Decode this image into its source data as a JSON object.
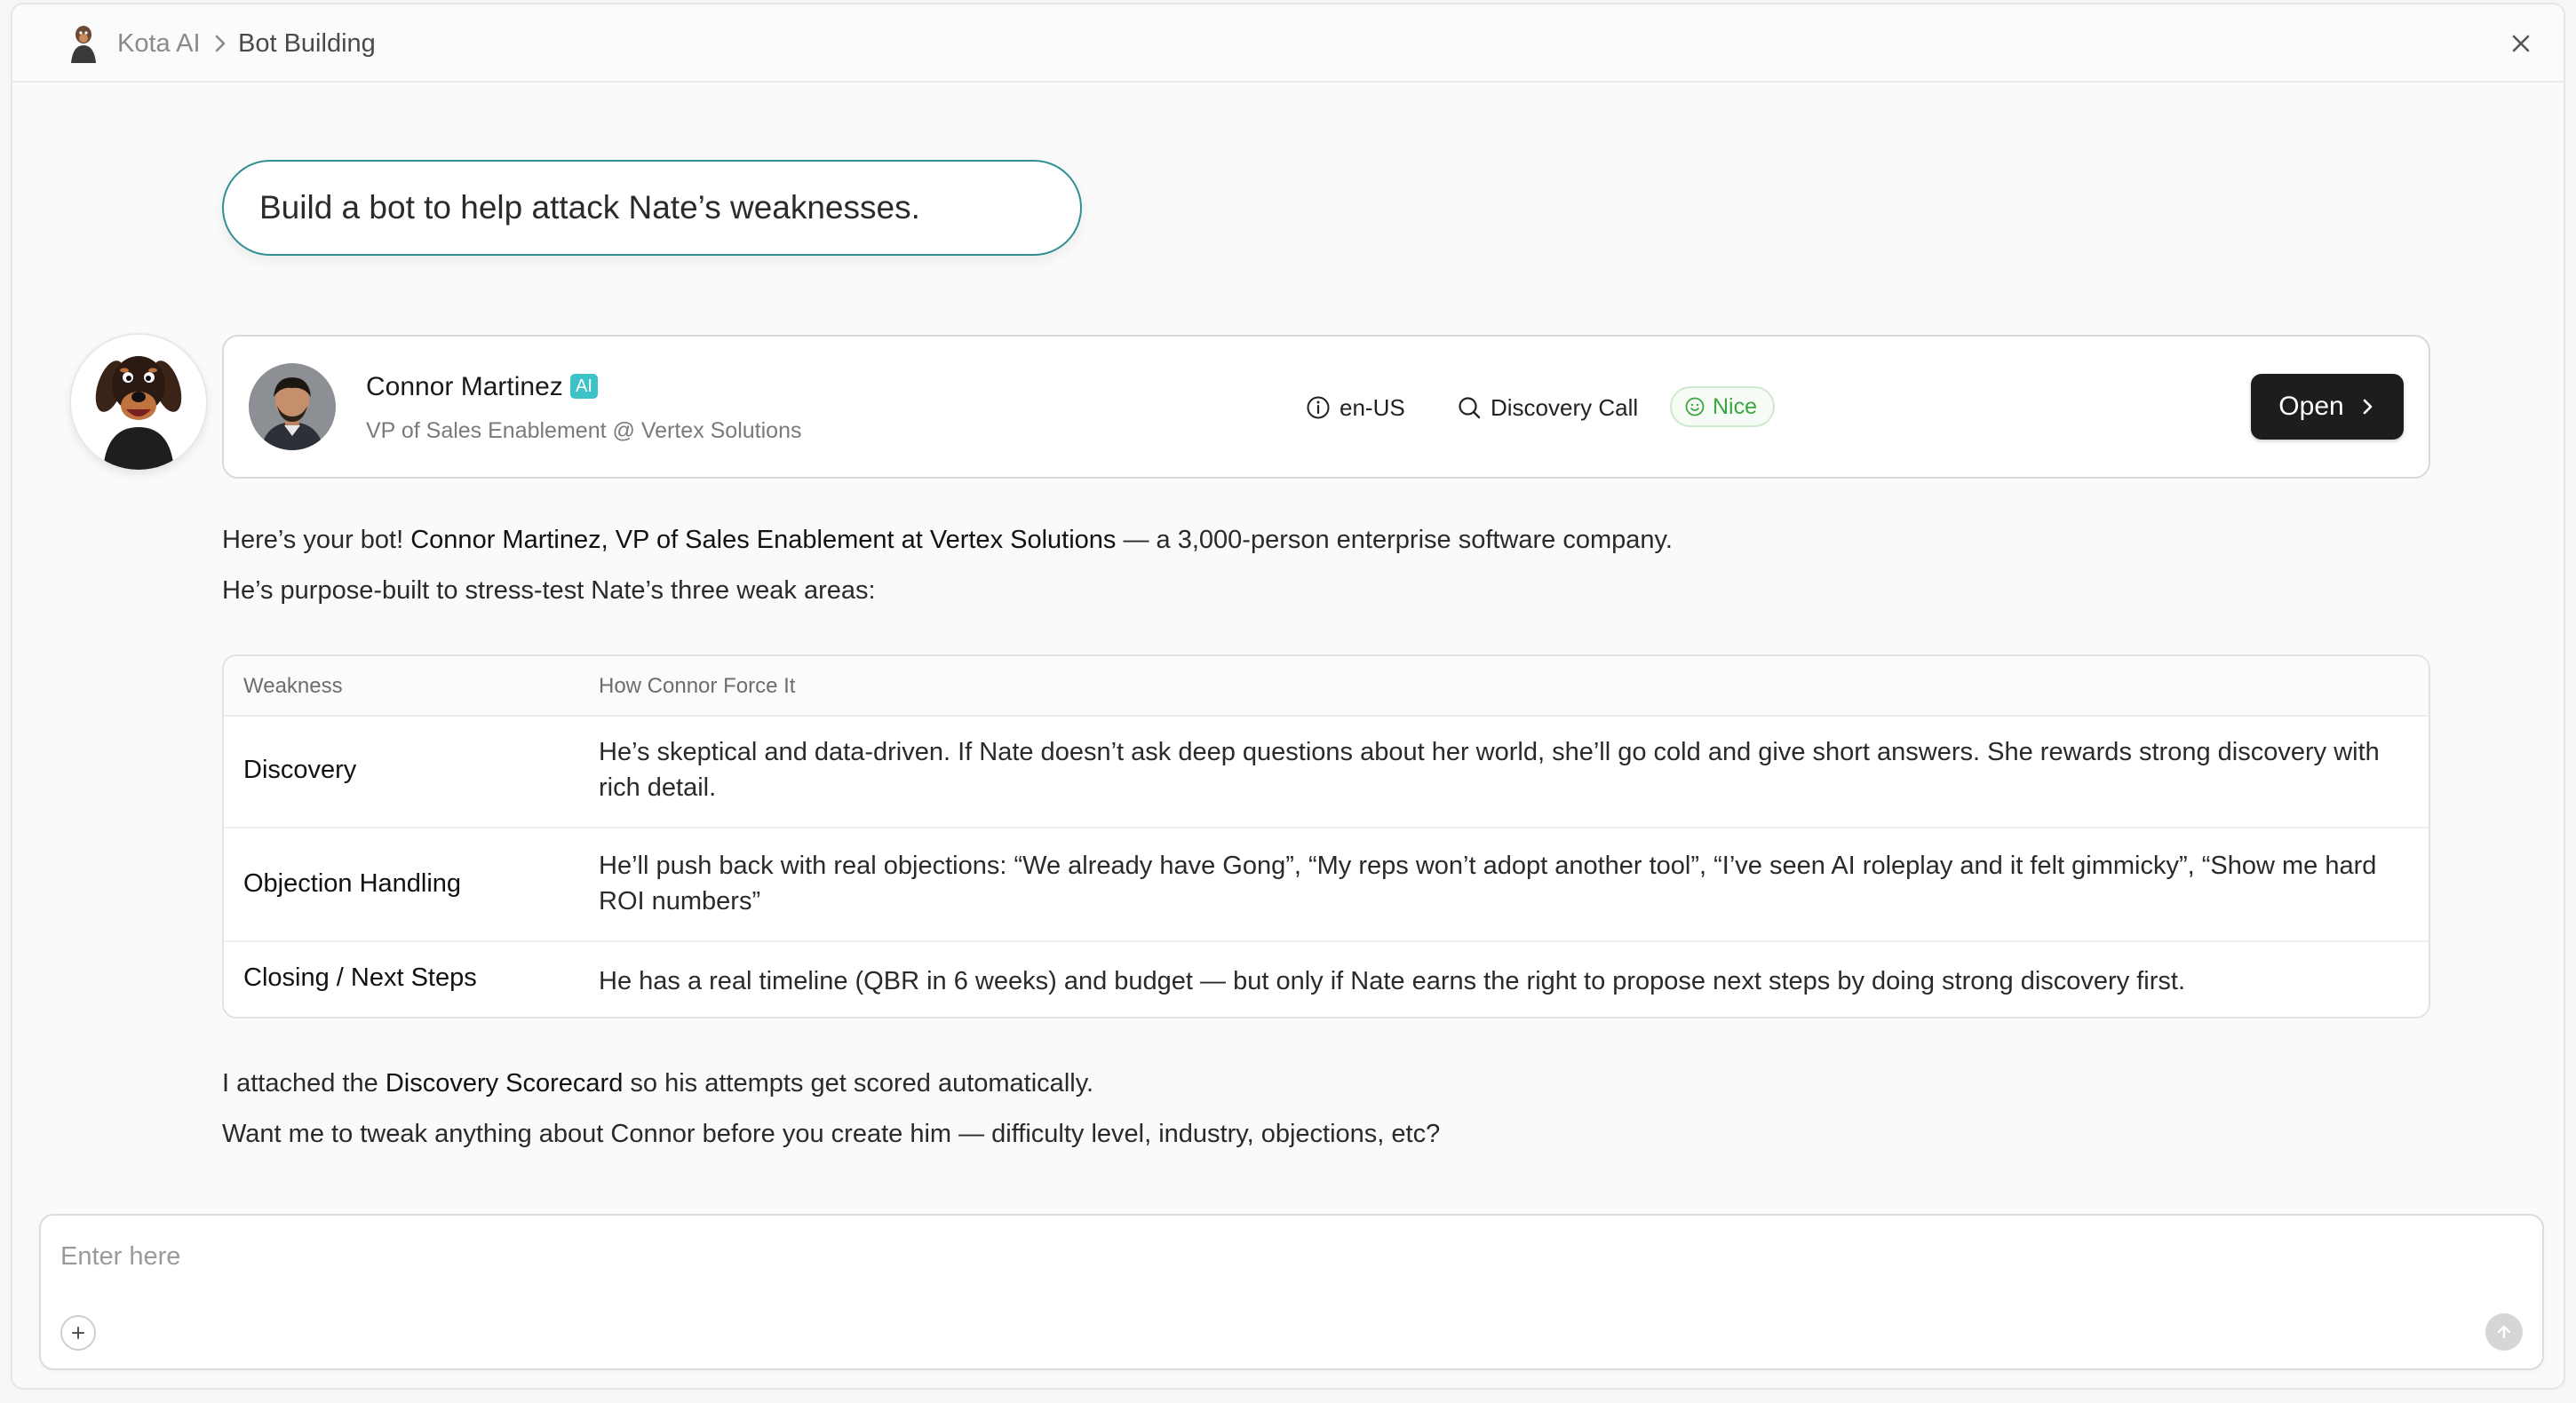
{
  "breadcrumb": {
    "root": "Kota AI",
    "current": "Bot Building"
  },
  "user_message": "Build a bot to help attack Nate’s weaknesses.",
  "persona": {
    "name": "Connor Martinez",
    "badge": "AI",
    "title": "VP of Sales Enablement @ Vertex Solutions",
    "locale": "en-US",
    "call_type": "Discovery Call",
    "tone": "Nice",
    "tone_color": "#3aa541",
    "open_label": "Open"
  },
  "reply": {
    "intro_plain": "Here’s your bot! ",
    "intro_bold": "Connor Martinez, VP of Sales Enablement at Vertex Solutions",
    "intro_rest": " — a 3,000-person enterprise software company.",
    "line2": "He’s purpose-built to stress-test Nate’s three weak areas:",
    "table": {
      "headers": [
        "Weakness",
        "How Connor Force It"
      ],
      "rows": [
        {
          "weakness": "Discovery",
          "how": "He’s skeptical and data-driven. If Nate doesn’t ask deep questions about her world, she’ll go cold and give short answers. She rewards strong discovery with rich detail."
        },
        {
          "weakness": "Objection Handling",
          "how": "He’ll push back with real objections: “We already have Gong”, “My reps won’t adopt another tool”, “I’ve seen AI roleplay and it felt gimmicky”, “Show me hard ROI numbers”"
        },
        {
          "weakness": "Closing / Next Steps",
          "how": "He has a real timeline (QBR in 6 weeks) and budget — but only if Nate earns the right to propose next steps by doing strong discovery first."
        }
      ]
    },
    "attach_plain": "I attached the ",
    "attach_bold": "Discovery Scorecard",
    "attach_rest": " so his attempts get scored automatically.",
    "closing": "Want me to tweak anything about Connor before you create him — difficulty level, industry, objections, etc?"
  },
  "composer": {
    "placeholder": "Enter here"
  },
  "colors": {
    "accent": "#2f8f92",
    "ai_badge": "#3cc2c7",
    "primary_button": "#1d1d1d"
  },
  "icons": {
    "close": "close-icon",
    "locale": "info-icon",
    "call_type": "search-icon",
    "tone": "smile-icon",
    "add": "plus-icon",
    "send": "arrow-up-icon"
  }
}
